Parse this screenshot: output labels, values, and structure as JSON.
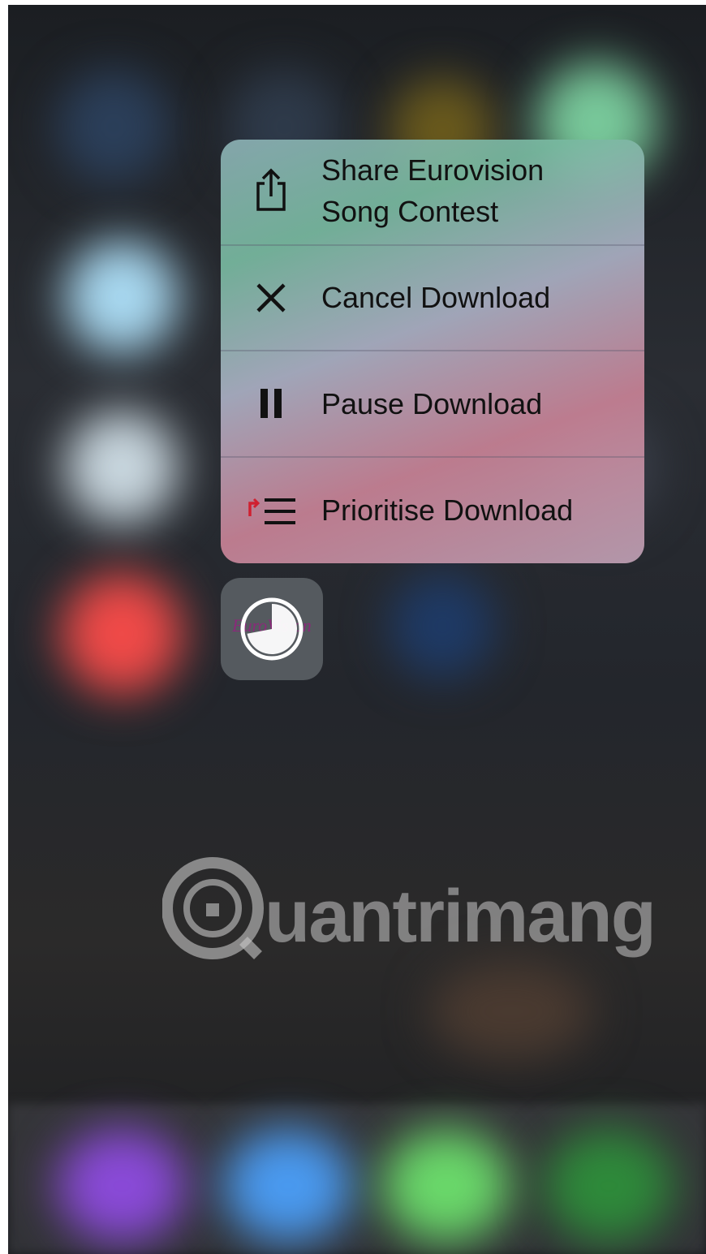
{
  "menu": {
    "items": [
      {
        "icon": "share-icon",
        "label_line1": "Share Eurovision",
        "label_line2": "Song Contest"
      },
      {
        "icon": "close-icon",
        "label": "Cancel Download"
      },
      {
        "icon": "pause-icon",
        "label": "Pause Download"
      },
      {
        "icon": "prioritise-icon",
        "label": "Prioritise Download"
      }
    ]
  },
  "app_icon": {
    "name": "eurovision-app-icon",
    "progress": 0.72,
    "logo_text": "EuroVision"
  },
  "watermark": {
    "text": "uantrimang"
  },
  "colors": {
    "accent_red": "#d94050",
    "background": "#23262c"
  }
}
